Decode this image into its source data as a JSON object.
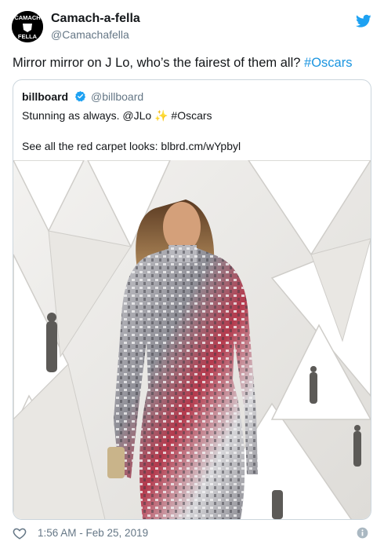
{
  "author": {
    "display_name": "Camach-a-fella",
    "handle": "@Camachafella",
    "avatar_text_top": "CAMACH",
    "avatar_text_bottom": "FELLA"
  },
  "tweet": {
    "text": "Mirror mirror on J Lo, who’s the fairest of them all?",
    "hashtag": "#Oscars"
  },
  "quoted": {
    "display_name": "billboard",
    "handle": "@billboard",
    "text_before": "Stunning as always. @JLo",
    "sparkle": "✨",
    "hashtag": "#Oscars",
    "link_text": "See all the red carpet looks: blbrd.cm/wYpbyl",
    "photo_description_icon": "photo-image"
  },
  "footer": {
    "timestamp": "1:56 AM - Feb 25, 2019"
  },
  "icons": {
    "brand": "twitter-bird-icon",
    "like": "heart-icon",
    "info": "info-icon",
    "verified": "verified-badge-icon"
  },
  "colors": {
    "link_blue": "#1b95e0",
    "twitter_blue": "#1da1f2",
    "muted": "#657786",
    "border": "#ccd6dd"
  }
}
